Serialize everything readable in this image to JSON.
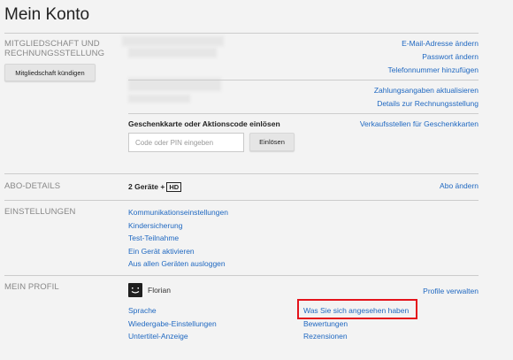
{
  "page_title": "Mein Konto",
  "membership": {
    "section_label_1": "MITGLIEDSCHAFT UND",
    "section_label_2": "RECHNUNGSSTELLUNG",
    "cancel_button": "Mitgliedschaft kündigen",
    "links_top": [
      "E-Mail-Adresse ändern",
      "Passwort ändern",
      "Telefonnummer hinzufügen"
    ],
    "links_payment": [
      "Zahlungsangaben aktualisieren",
      "Details zur Rechnungsstellung"
    ],
    "giftcard_heading": "Geschenkkarte oder Aktionscode einlösen",
    "giftcard_placeholder": "Code oder PIN eingeben",
    "redeem_button": "Einlösen",
    "retailers_link": "Verkaufsstellen für Geschenkkarten"
  },
  "plan": {
    "section_label": "ABO-DETAILS",
    "plan_text": "2 Geräte +",
    "hd_badge": "HD",
    "change_link": "Abo ändern"
  },
  "settings": {
    "section_label": "EINSTELLUNGEN",
    "links": [
      "Kommunikationseinstellungen",
      "Kindersicherung",
      "Test-Teilnahme",
      "Ein Gerät aktivieren",
      "Aus allen Geräten ausloggen"
    ]
  },
  "profile": {
    "section_label": "MEIN PROFIL",
    "name": "Florian",
    "manage_link": "Profile verwalten",
    "links_left": [
      "Sprache",
      "Wiedergabe-Einstellungen",
      "Untertitel-Anzeige"
    ],
    "links_right": [
      "Was Sie sich angesehen haben",
      "Bewertungen",
      "Rezensionen"
    ]
  },
  "colors": {
    "link": "#1f68c1",
    "highlight": "#e4131b",
    "background": "#f3f3f3"
  }
}
